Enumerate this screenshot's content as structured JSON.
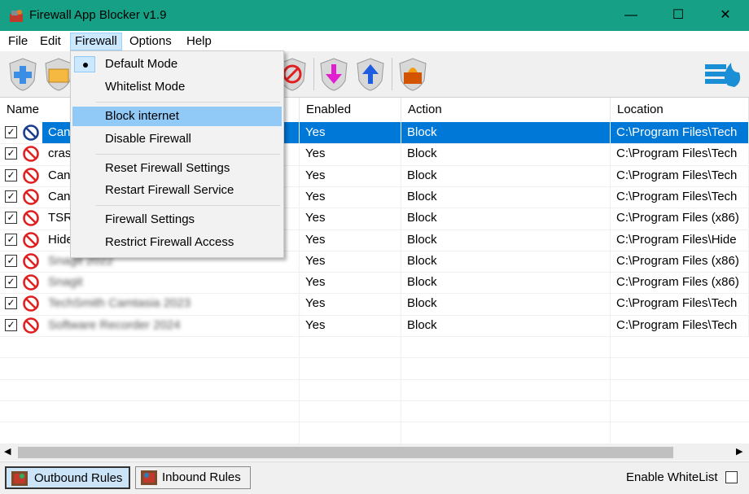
{
  "window": {
    "title": "Firewall App Blocker v1.9",
    "minimize_glyph": "—",
    "maximize_glyph": "☐",
    "close_glyph": "✕"
  },
  "menu": {
    "file": "File",
    "edit": "Edit",
    "firewall": "Firewall",
    "options": "Options",
    "help": "Help"
  },
  "toolbar": {
    "icons": [
      "add-icon",
      "folder-icon",
      "block-icon",
      "move-down-icon",
      "move-up-icon",
      "firewall-icon",
      "app-logo-icon"
    ]
  },
  "table": {
    "columns": [
      "Name",
      "Enabled",
      "Action",
      "Location"
    ],
    "rows": [
      {
        "name": "Can",
        "enabled": "Yes",
        "action": "Block",
        "location": "C:\\Program Files\\Tech",
        "checked": true,
        "blurred": false
      },
      {
        "name": "cras",
        "enabled": "Yes",
        "action": "Block",
        "location": "C:\\Program Files\\Tech",
        "checked": true,
        "blurred": false
      },
      {
        "name": "Can",
        "enabled": "Yes",
        "action": "Block",
        "location": "C:\\Program Files\\Tech",
        "checked": true,
        "blurred": false
      },
      {
        "name": "Can",
        "enabled": "Yes",
        "action": "Block",
        "location": "C:\\Program Files\\Tech",
        "checked": true,
        "blurred": false
      },
      {
        "name": "TSR",
        "enabled": "Yes",
        "action": "Block",
        "location": "C:\\Program Files (x86)",
        "checked": true,
        "blurred": false
      },
      {
        "name": "Hide",
        "enabled": "Yes",
        "action": "Block",
        "location": "C:\\Program Files\\Hide",
        "checked": true,
        "blurred": false
      },
      {
        "name": "Snagit 2022",
        "enabled": "Yes",
        "action": "Block",
        "location": "C:\\Program Files (x86)",
        "checked": true,
        "blurred": true
      },
      {
        "name": "Snagit",
        "enabled": "Yes",
        "action": "Block",
        "location": "C:\\Program Files (x86)",
        "checked": true,
        "blurred": true
      },
      {
        "name": "TechSmith Camtasia 2023",
        "enabled": "Yes",
        "action": "Block",
        "location": "C:\\Program Files\\Tech",
        "checked": true,
        "blurred": true
      },
      {
        "name": "Software Recorder 2024",
        "enabled": "Yes",
        "action": "Block",
        "location": "C:\\Program Files\\Tech",
        "checked": true,
        "blurred": true
      }
    ]
  },
  "firewall_menu": {
    "items": [
      {
        "label": "Default Mode"
      },
      {
        "label": "Whitelist Mode"
      },
      {
        "label": "Block internet"
      },
      {
        "label": "Disable Firewall"
      },
      {
        "label": "Reset Firewall Settings"
      },
      {
        "label": "Restart Firewall Service"
      },
      {
        "label": "Firewall Settings"
      },
      {
        "label": "Restrict Firewall Access"
      }
    ]
  },
  "status": {
    "outbound": "Outbound Rules",
    "inbound": "Inbound Rules",
    "whitelist": "Enable WhiteList"
  },
  "colors": {
    "titlebar": "#16a085",
    "selection": "#0078d7",
    "menu_highlight": "#91c9f7"
  }
}
